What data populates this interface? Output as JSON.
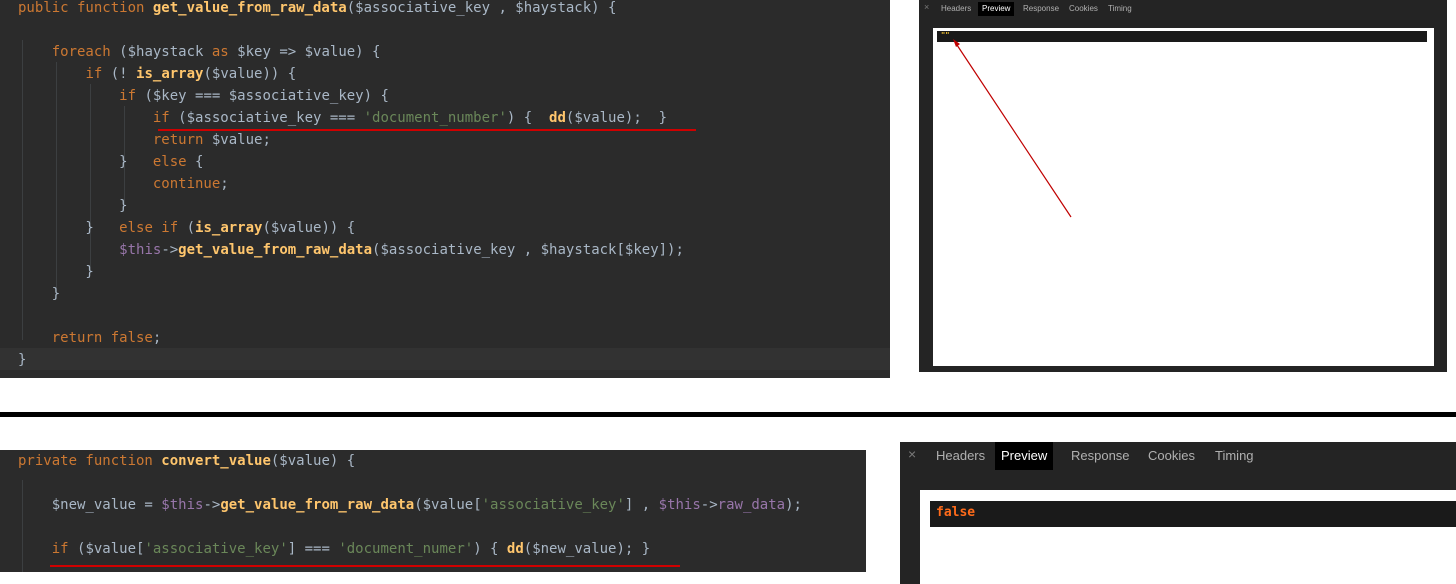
{
  "top_code": {
    "lines": [
      [
        [
          "k",
          "public function "
        ],
        [
          "f",
          "get_value_from_raw_data"
        ],
        [
          "v",
          "($associative_key , $haystack) {"
        ]
      ],
      [],
      [
        [
          "v",
          "    "
        ],
        [
          "k",
          "foreach "
        ],
        [
          "v",
          "($haystack "
        ],
        [
          "k",
          "as "
        ],
        [
          "v",
          "$key => $value) {"
        ]
      ],
      [
        [
          "v",
          "        "
        ],
        [
          "k",
          "if "
        ],
        [
          "v",
          "(! "
        ],
        [
          "f",
          "is_array"
        ],
        [
          "v",
          "($value)) {"
        ]
      ],
      [
        [
          "v",
          "            "
        ],
        [
          "k",
          "if "
        ],
        [
          "v",
          "($key === $associative_key) {"
        ]
      ],
      [
        [
          "v",
          "                "
        ],
        [
          "k",
          "if "
        ],
        [
          "v",
          "($associative_key === "
        ],
        [
          "s",
          "'document_number'"
        ],
        [
          "v",
          ") {  "
        ],
        [
          "f",
          "dd"
        ],
        [
          "v",
          "($value);  }"
        ]
      ],
      [
        [
          "v",
          "                "
        ],
        [
          "k",
          "return "
        ],
        [
          "v",
          "$value;"
        ]
      ],
      [
        [
          "v",
          "            }   "
        ],
        [
          "k",
          "else "
        ],
        [
          "v",
          "{"
        ]
      ],
      [
        [
          "v",
          "                "
        ],
        [
          "k",
          "continue"
        ],
        [
          "v",
          ";"
        ]
      ],
      [
        [
          "v",
          "            }"
        ]
      ],
      [
        [
          "v",
          "        }   "
        ],
        [
          "k",
          "else if "
        ],
        [
          "v",
          "("
        ],
        [
          "f",
          "is_array"
        ],
        [
          "v",
          "($value)) {"
        ]
      ],
      [
        [
          "v",
          "            "
        ],
        [
          "t",
          "$this"
        ],
        [
          "v",
          "->"
        ],
        [
          "f",
          "get_value_from_raw_data"
        ],
        [
          "v",
          "($associative_key , $haystack[$key]);"
        ]
      ],
      [
        [
          "v",
          "        }"
        ]
      ],
      [
        [
          "v",
          "    }"
        ]
      ],
      [],
      [
        [
          "v",
          "    "
        ],
        [
          "k",
          "return false"
        ],
        [
          "v",
          ";"
        ]
      ],
      [
        [
          "v",
          "}"
        ]
      ]
    ]
  },
  "bottom_code": {
    "lines": [
      [
        [
          "k",
          "private function "
        ],
        [
          "f",
          "convert_value"
        ],
        [
          "v",
          "($value) {"
        ]
      ],
      [],
      [
        [
          "v",
          "    $new_value = "
        ],
        [
          "t",
          "$this"
        ],
        [
          "v",
          "->"
        ],
        [
          "f",
          "get_value_from_raw_data"
        ],
        [
          "v",
          "($value["
        ],
        [
          "s",
          "'associative_key'"
        ],
        [
          "v",
          "] , "
        ],
        [
          "t",
          "$this"
        ],
        [
          "v",
          "->"
        ],
        [
          "t",
          "raw_data"
        ],
        [
          "v",
          ");"
        ]
      ],
      [],
      [
        [
          "v",
          "    "
        ],
        [
          "k",
          "if "
        ],
        [
          "v",
          "($value["
        ],
        [
          "s",
          "'associative_key'"
        ],
        [
          "v",
          "] === "
        ],
        [
          "s",
          "'document_numer'"
        ],
        [
          "v",
          ") { "
        ],
        [
          "f",
          "dd"
        ],
        [
          "v",
          "($new_value); }"
        ]
      ]
    ]
  },
  "top_devtools": {
    "close_glyph": "×",
    "tabs": [
      "Headers",
      "Preview",
      "Response",
      "Cookies",
      "Timing"
    ],
    "active_tab": "Preview",
    "result": "\"\""
  },
  "bottom_devtools": {
    "close_glyph": "×",
    "tabs": [
      "Headers",
      "Preview",
      "Response",
      "Cookies",
      "Timing"
    ],
    "active_tab": "Preview",
    "result": "false"
  },
  "colors": {
    "editor_bg": "#2b2b2b",
    "keyword": "#cc7832",
    "function": "#ffc66d",
    "string": "#6a8759",
    "this": "#9876aa",
    "underline": "#d00000",
    "arrow": "#c00000",
    "false_value": "#ff6b1a"
  }
}
